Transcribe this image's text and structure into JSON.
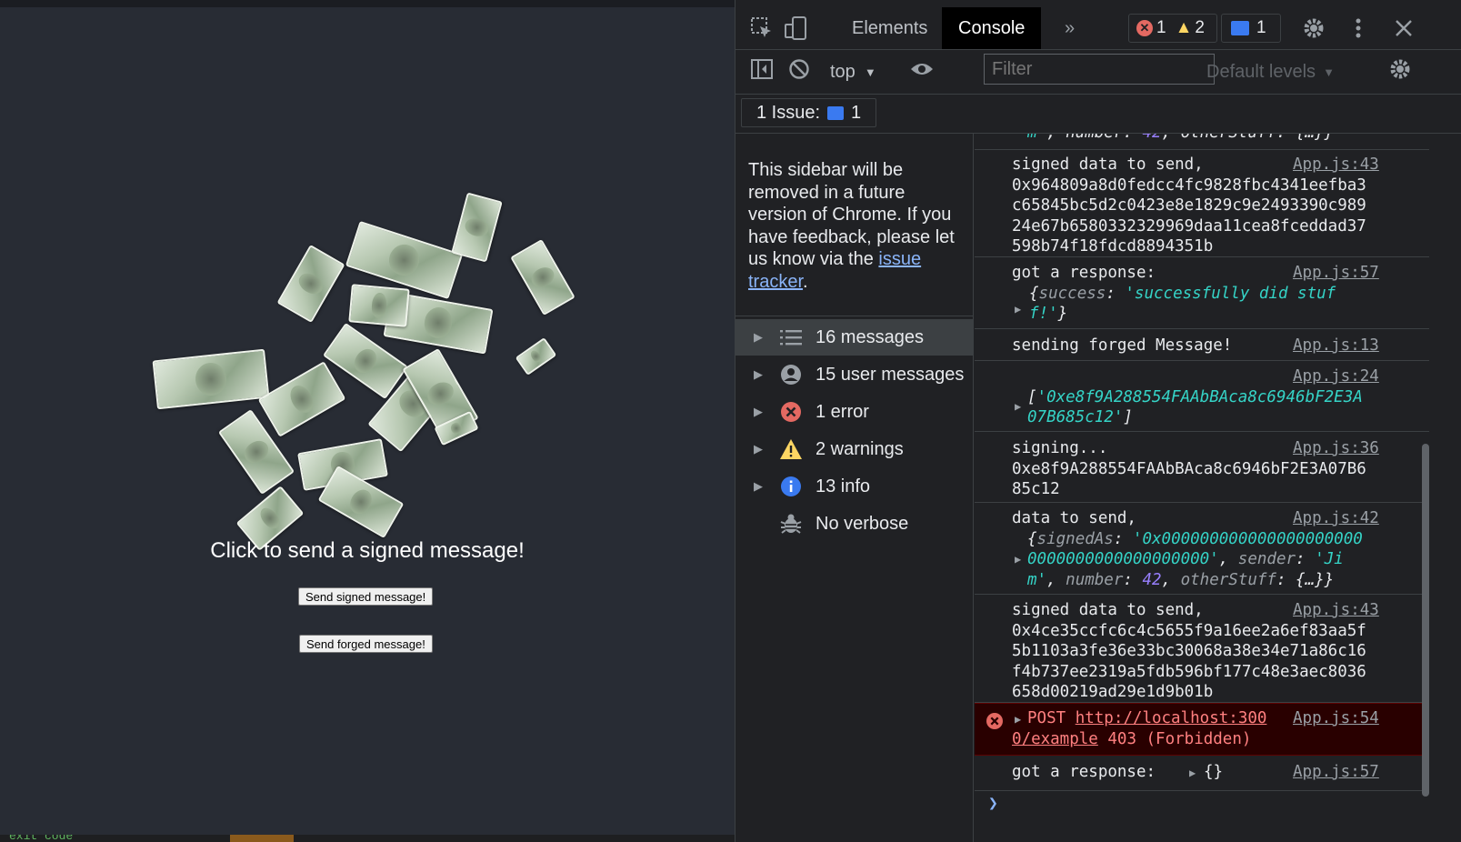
{
  "app": {
    "headline": "Click to send a signed message!",
    "buttons": {
      "send_signed": "Send signed message!",
      "send_forged": "Send forged message!"
    },
    "terminal_text": "exit code"
  },
  "devtools": {
    "tabs": {
      "elements": "Elements",
      "console": "Console",
      "more": "»"
    },
    "badges": {
      "errors": "1",
      "warnings": "2",
      "messages": "1"
    },
    "filterbar": {
      "context": "top",
      "filter_placeholder": "Filter",
      "levels": "Default levels"
    },
    "issues": {
      "label": "1 Issue:",
      "count": "1"
    },
    "sidebar": {
      "note_text": "This sidebar will be removed in a future version of Chrome. If you have feedback, please let us know via the ",
      "note_link": "issue tracker",
      "note_end": ".",
      "items": [
        {
          "label": "16 messages",
          "icon": "list-icon"
        },
        {
          "label": "15 user messages",
          "icon": "user-icon"
        },
        {
          "label": "1 error",
          "icon": "error-icon"
        },
        {
          "label": "2 warnings",
          "icon": "warning-icon"
        },
        {
          "label": "13 info",
          "icon": "info-icon"
        },
        {
          "label": "No verbose",
          "icon": "bug-icon"
        }
      ]
    },
    "console": {
      "messages": [
        {
          "type": "fragment",
          "text_a": "m'",
          "text_b": ", number: ",
          "num": "42",
          "text_c": ", otherStuff: {…}}"
        },
        {
          "type": "log",
          "source": "App.js:43",
          "lines": [
            "signed data to send,",
            "0x964809a8d0fedcc4fc9828fbc4341eefba3",
            "c65845bc5d2c0423e8e1829c9e2493390c989",
            "24e67b6580332329969daa11cea8fceddad37",
            "598b74f18fdcd8894351b"
          ]
        },
        {
          "type": "log",
          "source": "App.js:57",
          "label": "got a response:",
          "obj_key": "success",
          "obj_val_1": "'successfully did stuf",
          "obj_val_2": "f!'"
        },
        {
          "type": "log",
          "source": "App.js:13",
          "label": "sending forged Message!"
        },
        {
          "type": "log",
          "source": "App.js:24",
          "arr_1": "'0xe8f9A288554FAAbBAca8c6946bF2E3A",
          "arr_2": "07B685c12'"
        },
        {
          "type": "log",
          "source": "App.js:36",
          "lines": [
            "signing...",
            "0xe8f9A288554FAAbBAca8c6946bF2E3A07B6",
            "85c12"
          ]
        },
        {
          "type": "log",
          "source": "App.js:42",
          "label": "data to send,",
          "k1": "signedAs",
          "v1a": "'0x000000000000000000000",
          "v1b": "0000000000000000000'",
          "k2": "sender",
          "v2a": "'Ji",
          "v2b": "m'",
          "k3": "number",
          "v3": "42",
          "k4": "otherStuff",
          "v4": "{…}"
        },
        {
          "type": "log",
          "source": "App.js:43",
          "lines": [
            "signed data to send,",
            "0x4ce35ccfc6c4c5655f9a16ee2a6ef83aa5f",
            "5b1103a3fe36e33bc30068a38e34e71a86c16",
            "f4b737ee2319a5fdb596bf177c48e3aec8036",
            "658d00219ad29e1d9b01b"
          ]
        },
        {
          "type": "error",
          "source": "App.js:54",
          "method": "POST",
          "url_1": "http://localhost:300",
          "url_2": "0/example",
          "status": "403 (Forbidden)"
        },
        {
          "type": "log",
          "source": "App.js:57",
          "label": "got a response:",
          "obj": "{}"
        }
      ]
    }
  }
}
